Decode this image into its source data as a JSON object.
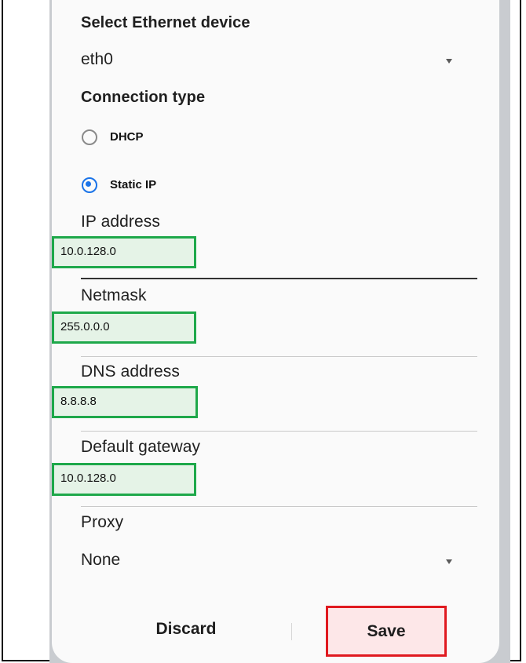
{
  "ethernet": {
    "device_title": "Select Ethernet device",
    "device_value": "eth0"
  },
  "connection": {
    "title": "Connection type",
    "options": [
      {
        "label": "DHCP",
        "selected": false
      },
      {
        "label": "Static IP",
        "selected": true
      }
    ]
  },
  "fields": {
    "ip": {
      "label": "IP address",
      "value": "10.0.128.0"
    },
    "netmask": {
      "label": "Netmask",
      "value": "255.0.0.0"
    },
    "dns": {
      "label": "DNS address",
      "value": "8.8.8.8"
    },
    "gateway": {
      "label": "Default gateway",
      "value": "10.0.128.0"
    }
  },
  "proxy": {
    "title": "Proxy",
    "value": "None"
  },
  "actions": {
    "discard_label": "Discard",
    "save_label": "Save"
  },
  "colors": {
    "accent": "#1a73e8",
    "highlight_green": "#1ea84a",
    "highlight_red": "#e0191f"
  },
  "icons": {
    "dropdown": "caret-down-icon"
  }
}
